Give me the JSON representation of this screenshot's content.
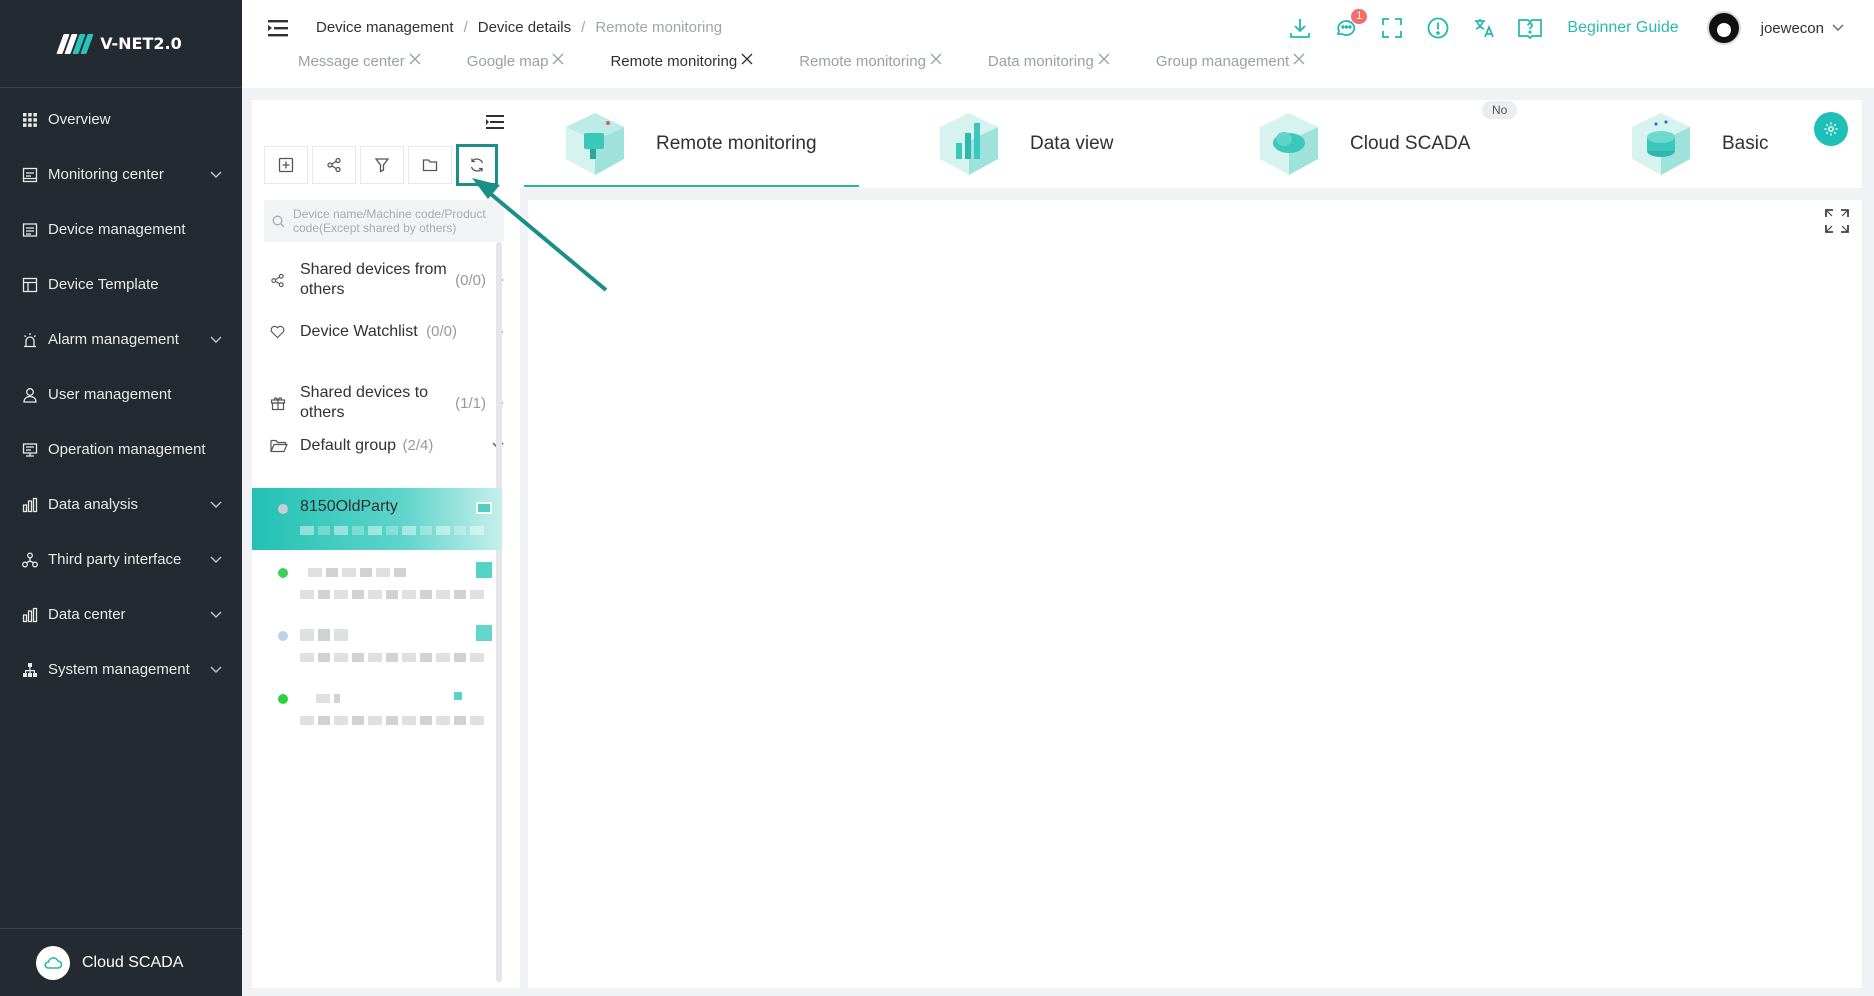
{
  "sidebar": {
    "logo_text": "V-NET2.0",
    "items": [
      {
        "label": "Overview",
        "icon": "grid-icon",
        "expand": false
      },
      {
        "label": "Monitoring center",
        "icon": "monitor-icon",
        "expand": true
      },
      {
        "label": "Device management",
        "icon": "device-icon",
        "expand": false
      },
      {
        "label": "Device Template",
        "icon": "template-icon",
        "expand": false
      },
      {
        "label": "Alarm management",
        "icon": "alarm-icon",
        "expand": true
      },
      {
        "label": "User management",
        "icon": "user-icon",
        "expand": false
      },
      {
        "label": "Operation management",
        "icon": "operation-icon",
        "expand": false
      },
      {
        "label": "Data analysis",
        "icon": "bar-chart-icon",
        "expand": true
      },
      {
        "label": "Third party interface",
        "icon": "network-icon",
        "expand": true
      },
      {
        "label": "Data center",
        "icon": "bar-chart-icon",
        "expand": true
      },
      {
        "label": "System management",
        "icon": "org-icon",
        "expand": true
      }
    ],
    "bottom_label": "Cloud SCADA"
  },
  "header": {
    "breadcrumb": [
      "Device management",
      "Device details",
      "Remote monitoring"
    ],
    "tabs": [
      {
        "label": "Message center",
        "active": false
      },
      {
        "label": "Google map",
        "active": false
      },
      {
        "label": "Remote monitoring",
        "active": true
      },
      {
        "label": "Remote monitoring",
        "active": false
      },
      {
        "label": "Data monitoring",
        "active": false
      },
      {
        "label": "Group management",
        "active": false
      }
    ],
    "message_badge": "1",
    "guide_label": "Beginner Guide",
    "username": "joewecon"
  },
  "left_panel": {
    "search_placeholder": "Device name/Machine code/Product code(Except shared by others)",
    "shared_from_label": "Shared devices from others",
    "shared_from_count": "(0/0)",
    "watchlist_label": "Device Watchlist",
    "watchlist_count": "(0/0)",
    "shared_to_label": "Shared devices to others",
    "shared_to_count": "(1/1)",
    "group_label": "Default group",
    "group_count": "(2/4)",
    "selected_device": "8150OldParty"
  },
  "main": {
    "cards": [
      "Remote monitoring",
      "Data view",
      "Cloud SCADA",
      "Basic"
    ],
    "no_badge": "No"
  },
  "colors": {
    "accent": "#22b8ae",
    "sidebar_bg": "#232a31",
    "arrow": "#1a8f88"
  }
}
